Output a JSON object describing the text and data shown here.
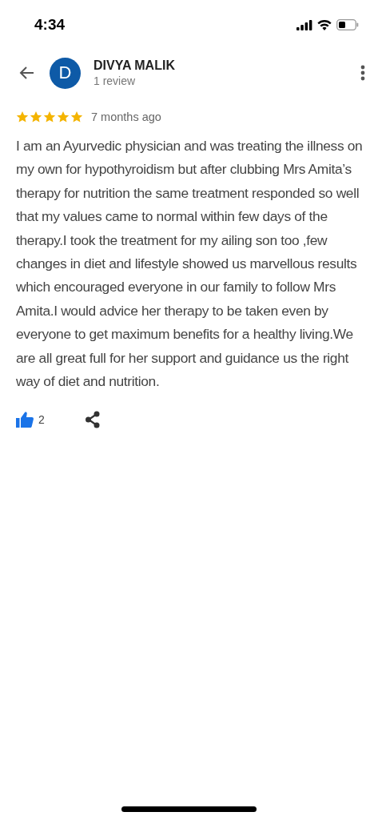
{
  "status_bar": {
    "time": "4:34"
  },
  "reviewer": {
    "initial": "D",
    "name": "DIVYA MALIK",
    "review_count": "1 review"
  },
  "review": {
    "stars": 5,
    "time": "7 months ago",
    "text": "I am an Ayurvedic physician and was treating the illness on my own for hypothyroidism but after clubbing Mrs Amita’s therapy for nutrition the same treatment responded so well that my values came to normal within few days of the therapy.I took the treatment for my ailing son too ,few changes in diet and lifestyle showed us marvellous results which encouraged everyone in our family to follow Mrs Amita.I would advice her therapy to be taken even by everyone to get maximum benefits for a healthy living.We are all great full for her support and guidance us the right way of diet and nutrition.",
    "likes": "2"
  }
}
